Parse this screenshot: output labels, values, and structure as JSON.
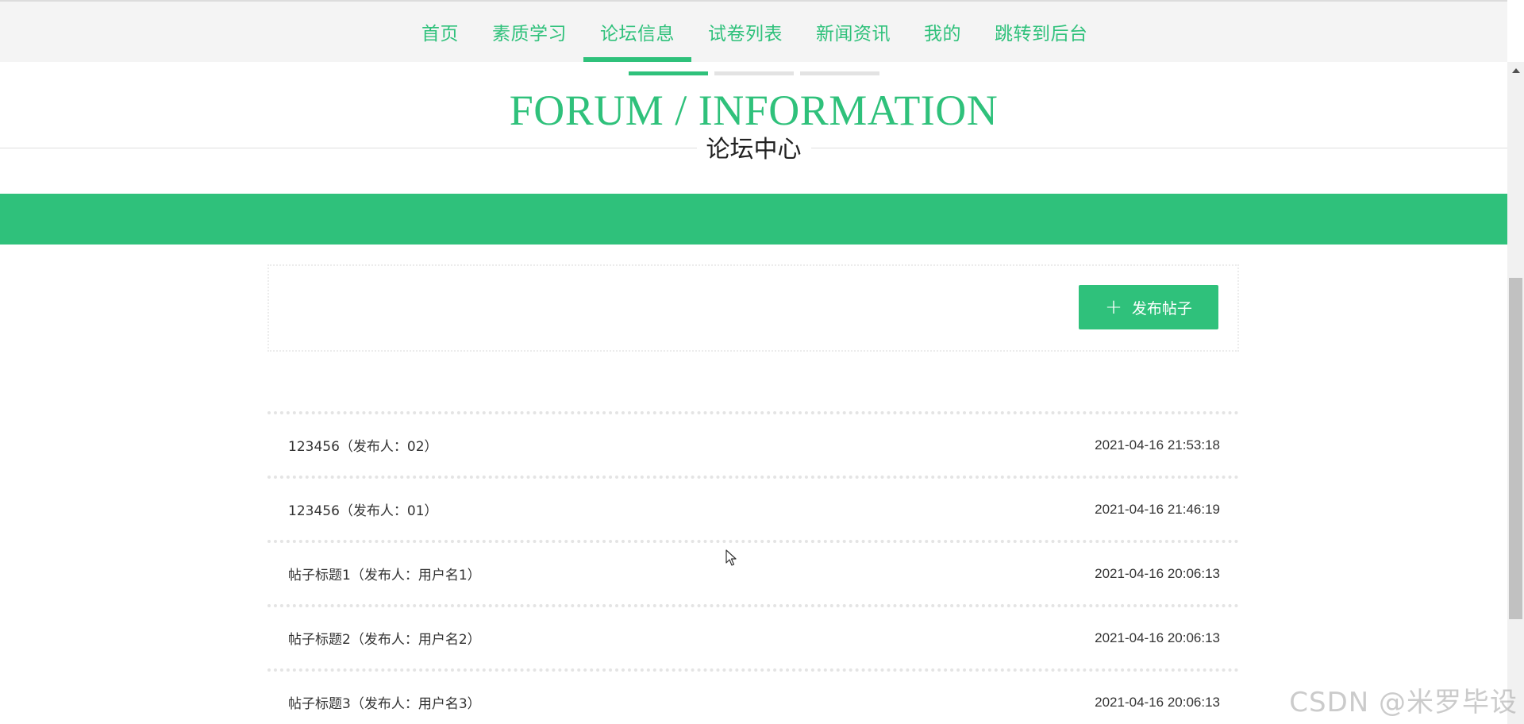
{
  "nav": {
    "items": [
      {
        "label": "首页"
      },
      {
        "label": "素质学习"
      },
      {
        "label": "论坛信息"
      },
      {
        "label": "试卷列表"
      },
      {
        "label": "新闻资讯"
      },
      {
        "label": "我的"
      },
      {
        "label": "跳转到后台"
      }
    ],
    "active_index": 2,
    "accent_color": "#2fc17b"
  },
  "section": {
    "title_en": "FORUM / INFORMATION",
    "title_cn": "论坛中心"
  },
  "toolbar": {
    "publish_label": "发布帖子",
    "publish_icon": "plus-icon"
  },
  "posts": [
    {
      "title": "123456（发布人：02）",
      "time": "2021-04-16 21:53:18"
    },
    {
      "title": "123456（发布人：01）",
      "time": "2021-04-16 21:46:19"
    },
    {
      "title": "帖子标题1（发布人：用户名1）",
      "time": "2021-04-16 20:06:13"
    },
    {
      "title": "帖子标题2（发布人：用户名2）",
      "time": "2021-04-16 20:06:13"
    },
    {
      "title": "帖子标题3（发布人：用户名3）",
      "time": "2021-04-16 20:06:13"
    }
  ],
  "watermark": "CSDN @米罗毕设"
}
